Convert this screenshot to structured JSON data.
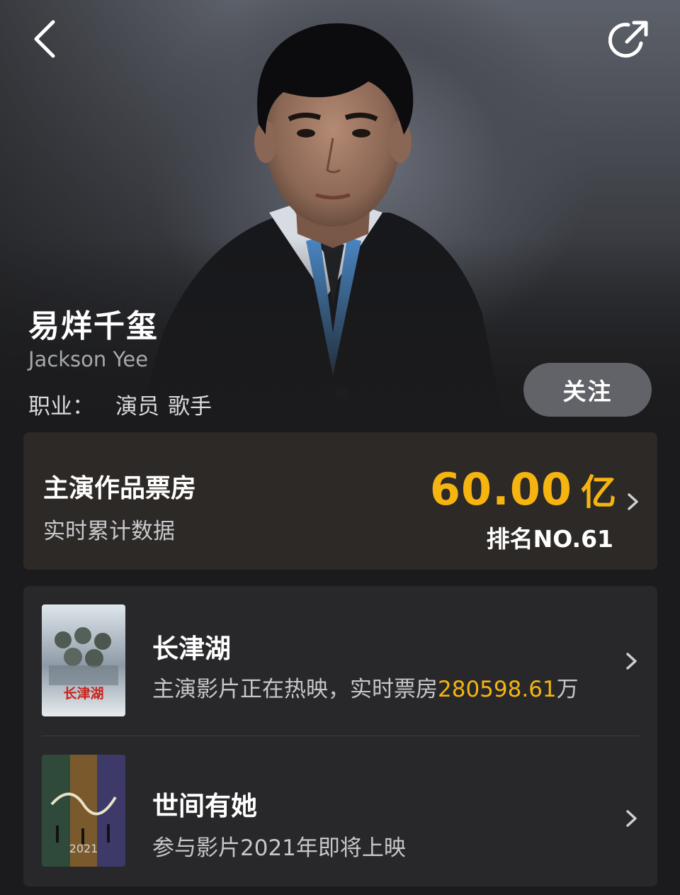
{
  "header": {
    "back_icon": "back-chevron-icon",
    "share_icon": "share-icon"
  },
  "profile": {
    "name_cn": "易烊千玺",
    "name_en": "Jackson Yee",
    "job_label": "职业：",
    "jobs": [
      "演员",
      "歌手"
    ],
    "follow_label": "关注"
  },
  "box_office": {
    "title": "主演作品票房",
    "subtitle": "实时累计数据",
    "amount": "60.00",
    "unit": "亿",
    "rank": "排名NO.61",
    "accent_color": "#f5b40f"
  },
  "films": [
    {
      "title": "长津湖",
      "desc_prefix": "主演影片正在热映，实时票房",
      "desc_value": "280598.61",
      "desc_suffix": "万",
      "poster_text": "长津湖"
    },
    {
      "title": "世间有她",
      "desc_prefix": "参与影片2021年即将上映",
      "poster_text": "2021"
    }
  ]
}
